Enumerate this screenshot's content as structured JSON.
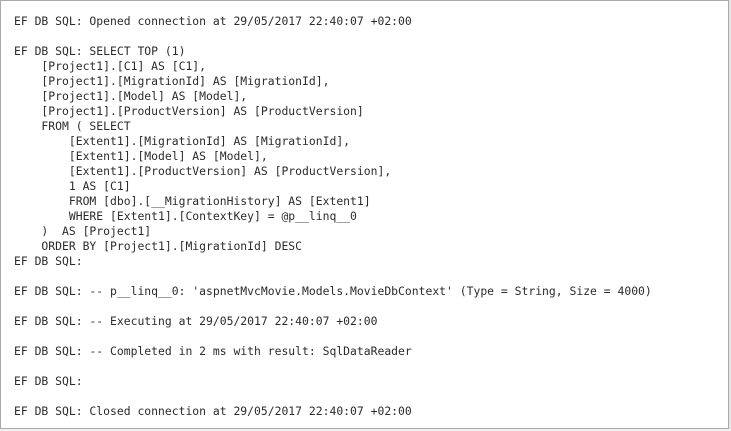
{
  "output": {
    "lines": [
      "EF DB SQL: Opened connection at 29/05/2017 22:40:07 +02:00",
      "",
      "EF DB SQL: SELECT TOP (1)",
      "    [Project1].[C1] AS [C1],",
      "    [Project1].[MigrationId] AS [MigrationId],",
      "    [Project1].[Model] AS [Model],",
      "    [Project1].[ProductVersion] AS [ProductVersion]",
      "    FROM ( SELECT",
      "        [Extent1].[MigrationId] AS [MigrationId],",
      "        [Extent1].[Model] AS [Model],",
      "        [Extent1].[ProductVersion] AS [ProductVersion],",
      "        1 AS [C1]",
      "        FROM [dbo].[__MigrationHistory] AS [Extent1]",
      "        WHERE [Extent1].[ContextKey] = @p__linq__0",
      "    )  AS [Project1]",
      "    ORDER BY [Project1].[MigrationId] DESC",
      "EF DB SQL:",
      "",
      "EF DB SQL: -- p__linq__0: 'aspnetMvcMovie.Models.MovieDbContext' (Type = String, Size = 4000)",
      "",
      "EF DB SQL: -- Executing at 29/05/2017 22:40:07 +02:00",
      "",
      "EF DB SQL: -- Completed in 2 ms with result: SqlDataReader",
      "",
      "EF DB SQL:",
      "",
      "EF DB SQL: Closed connection at 29/05/2017 22:40:07 +02:00"
    ]
  }
}
